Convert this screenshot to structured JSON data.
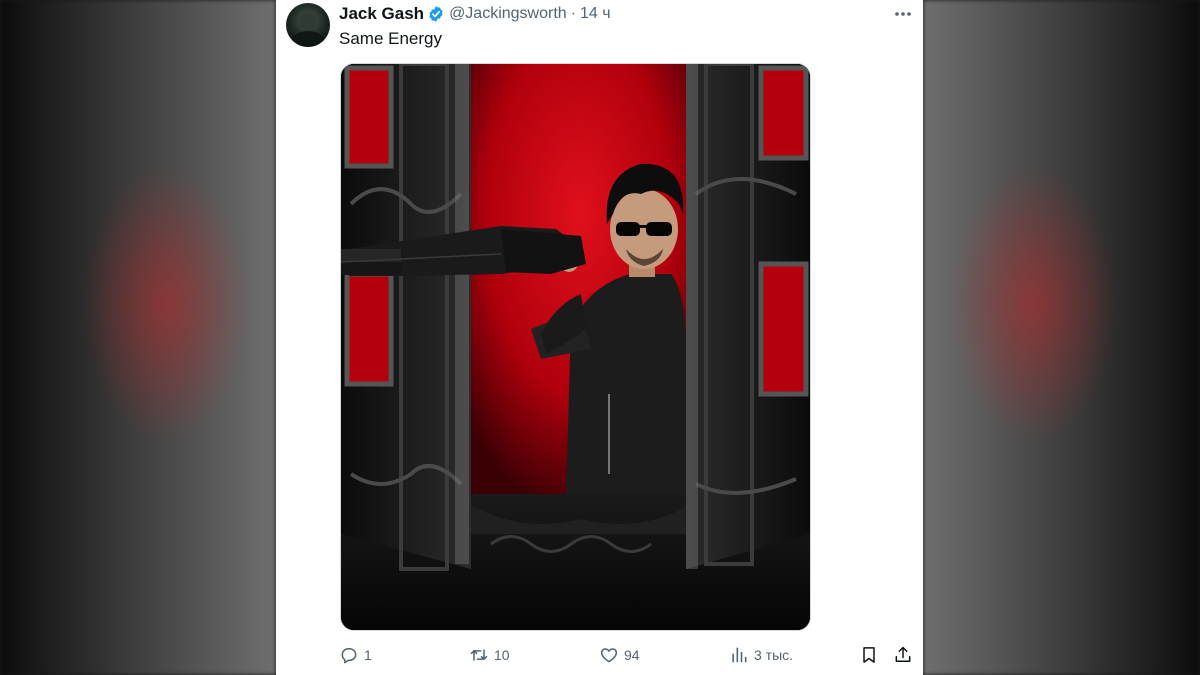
{
  "tweet": {
    "author_name": "Jack Gash",
    "handle": "@Jackingsworth",
    "separator": "·",
    "time": "14 ч",
    "text": "Same Energy"
  },
  "actions": {
    "replies": "1",
    "retweets": "10",
    "likes": "94",
    "views": "3 тыс."
  },
  "icons": {
    "verified": "verified-badge-icon",
    "more": "more-icon",
    "reply": "reply-icon",
    "retweet": "retweet-icon",
    "like": "heart-icon",
    "views": "views-icon",
    "bookmark": "bookmark-icon",
    "share": "share-icon"
  },
  "colors": {
    "verified": "#1d9bf0",
    "secondary_text": "#536471",
    "primary_text": "#0f1419"
  }
}
